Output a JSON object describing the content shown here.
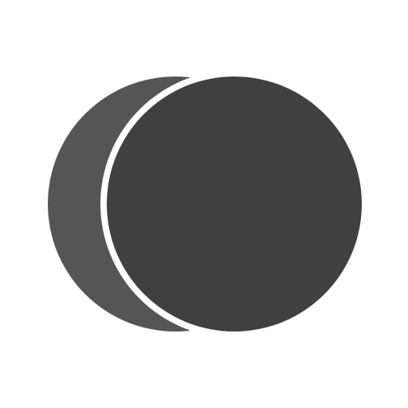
{
  "icon": {
    "name": "overlapping-circles-icon",
    "colors": {
      "background": "#ffffff",
      "back_circle": "#555555",
      "front_circle": "#404040",
      "gap": "#ffffff"
    }
  }
}
